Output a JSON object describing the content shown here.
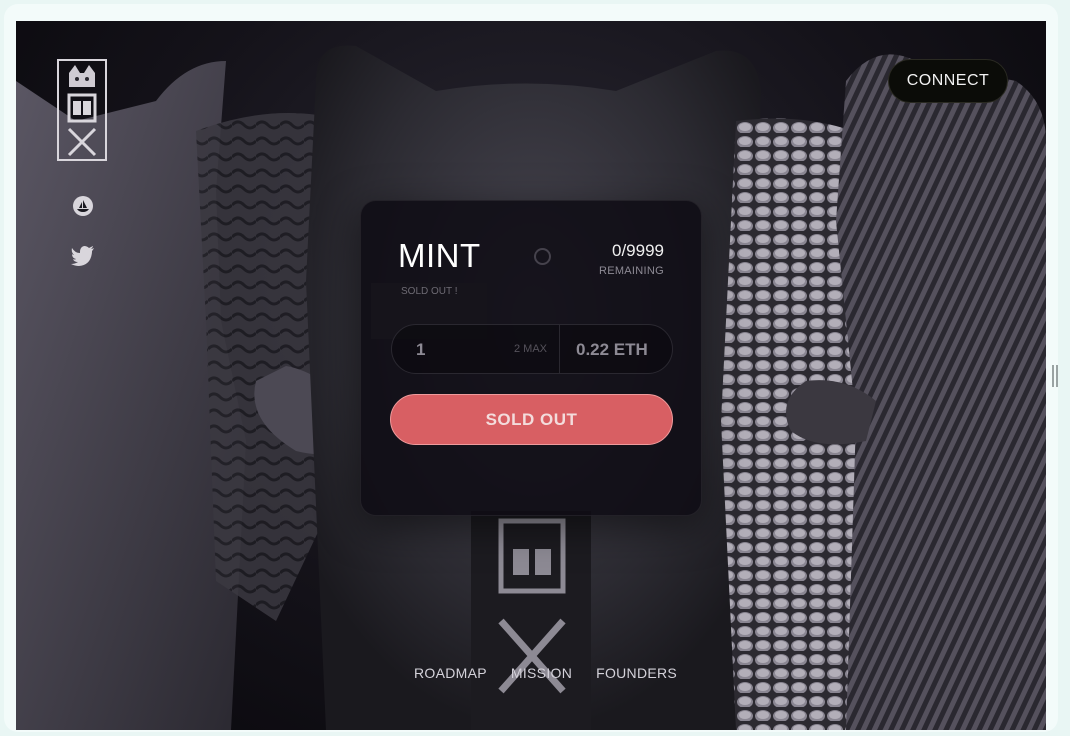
{
  "header": {
    "connect_label": "CONNECT"
  },
  "logo": {
    "brand": "XIBE"
  },
  "social": [
    {
      "name": "opensea-icon"
    },
    {
      "name": "twitter-icon"
    }
  ],
  "mint": {
    "title": "MINT",
    "supply_count": "0/9999",
    "supply_label": "REMAINING",
    "sold_out_note": "SOLD OUT !",
    "quantity_value": "1",
    "max_label": "2 MAX",
    "price": "0.22 ETH",
    "action_label": "SOLD OUT"
  },
  "nav": {
    "items": [
      "ROADMAP",
      "MISSION",
      "FOUNDERS"
    ]
  },
  "colors": {
    "accent": "#d85f63",
    "card_bg": "#0e0c14",
    "page_bg": "#e9f6f4"
  }
}
